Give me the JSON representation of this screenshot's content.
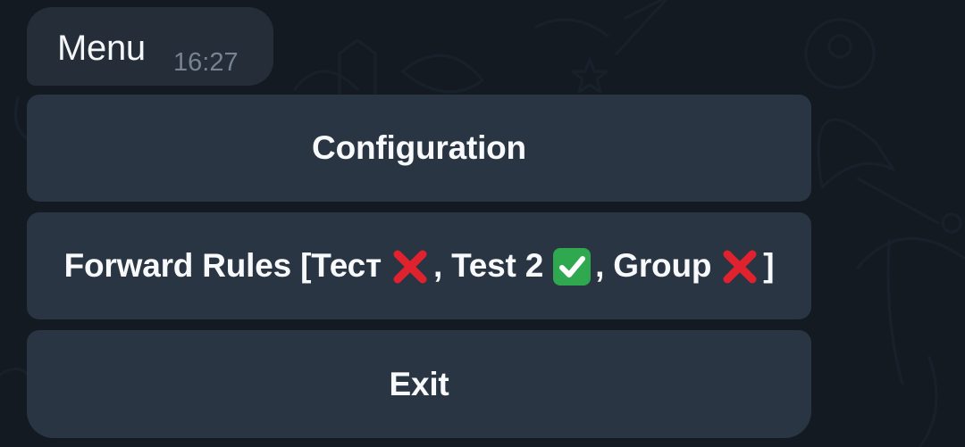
{
  "message": {
    "text": "Menu",
    "time": "16:27"
  },
  "keyboard": {
    "buttons": [
      {
        "label": "Configuration"
      },
      {
        "label": "Forward Rules [Тест ❌, Test 2 ✅, Group ❌]",
        "parts": {
          "prefix": "Forward Rules [Тест",
          "item_1_status_icon": "cross-mark-icon",
          "item_2_text": ", Test 2",
          "item_2_status_icon": "check-mark-button-icon",
          "item_3_text": ", Group",
          "item_3_status_icon": "cross-mark-icon",
          "suffix": "]"
        }
      },
      {
        "label": "Exit"
      }
    ]
  },
  "colors": {
    "background": "#131a22",
    "bubble": "#242d38",
    "button": "#2a3543",
    "text": "#f4f6f8",
    "time": "#778391",
    "cross": "#e0212e",
    "check": "#2fa84f"
  }
}
